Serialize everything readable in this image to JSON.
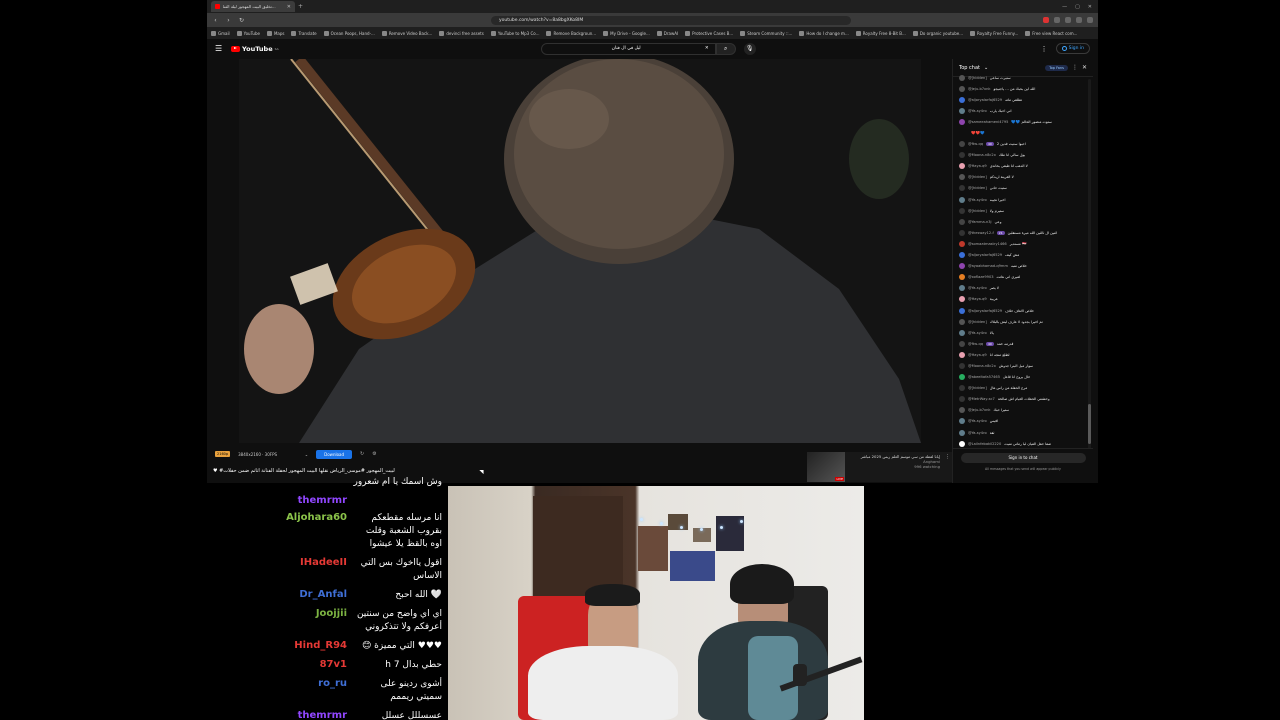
{
  "browser": {
    "tab_title": "تخليق البيت المهجور ليلة الفنا...",
    "url": "youtube.com/watch?v=8a8bgXKo8IM",
    "bookmarks": [
      "Gmail",
      "YouTube",
      "Maps",
      "Translate",
      "Ocean Poops, Hand-...",
      "Remove Video Back...",
      "devinci free assets",
      "YouTube to Mp3 Co...",
      "Remove Backgroun...",
      "My Drive - Google...",
      "DrawAI",
      "Protective Cases B...",
      "Steam Community ::...",
      "How do I change m...",
      "Royalty Free 8-Bit B...",
      "Do organic youtube...",
      "Royalty Free Funny...",
      "Free view React com..."
    ]
  },
  "youtube": {
    "logo": "YouTube",
    "logo_sup": "SA",
    "search_value": "ليل في ال فنان",
    "signin": "Sign in"
  },
  "downloader": {
    "badge": "2160p",
    "quality": "3840x2160 · 30FPS",
    "button": "Download"
  },
  "video_title": {
    "prefix": "كيف نصرفت #لبيت_المهجور #",
    "highlight": "#لبيت_المهجور ليلة الفنانة اتاتم ضمن حفلات",
    "full": "♥ #لبيت_المهجور #موسى_الرياض نقلها البيت المهجور لحفلة الفنانة اتاتم ضمن حفلات"
  },
  "live_card": {
    "title": "إيانا لقطة من سي موسم العلم ريس 2025 مباشر",
    "channel": "Anghami",
    "watching": "996 watching",
    "live": "LIVE"
  },
  "chat": {
    "header": "Top chat",
    "top_fans": "Top Fans",
    "signin": "Sign in to chat",
    "note": "All messages that you send will appear publicly",
    "messages": [
      {
        "user": "@[hidden]",
        "text": "ستيرت ساعي",
        "color": "#555"
      },
      {
        "user": "@Jeju-b7xnk",
        "text": "الله اين بحبك من ... ياجنيجو",
        "color": "#555"
      },
      {
        "user": "@aljoryalarfaj6529",
        "text": "تطلقي ماته",
        "color": "#3a6fd8"
      },
      {
        "user": "@Ya-sy4ro",
        "text": "اني احبك يارب",
        "color": "#607d8b"
      },
      {
        "user": "@sameeahameni4795",
        "text": "💙💙 ستوت منصور الحالم",
        "color": "#8e44ad"
      },
      {
        "user": "",
        "text": "❤️❤️💙",
        "color": "transparent"
      },
      {
        "user": "@ftw-qq",
        "text": "احبوا ستيت فدين 2",
        "pill": "40",
        "color": "#444"
      },
      {
        "user": "@Moona-n8c2x",
        "text": "يول سالي انا ملك",
        "color": "#333"
      },
      {
        "user": "@Haya-q9",
        "text": "لا الدهب انا طبقي بخاندي",
        "color": "#e8a0b0"
      },
      {
        "user": "@[hidden]",
        "text": "لا الغرينة اريدكم",
        "color": "#555"
      },
      {
        "user": "@[hidden]",
        "text": "ستيت حاني",
        "color": "#333"
      },
      {
        "user": "@Ya-sy4ro",
        "text": "اخيرا نجيبه",
        "color": "#607d8b"
      },
      {
        "user": "@[hidden]",
        "text": "ستيرم ولا",
        "color": "#333"
      },
      {
        "user": "@Yamma-n3j",
        "text": "وعي",
        "color": "#444"
      },
      {
        "user": "@thesway12-f",
        "text": "اثنين ال ثالثين الله ميرة مستقلين",
        "pill": "21",
        "color": "#333"
      },
      {
        "user": "@somaatmastry1466",
        "text": "مستدبر 🇪🇬",
        "color": "#c0392b"
      },
      {
        "user": "@aljoryalarfaj6529",
        "text": "مش كيف",
        "color": "#3a6fd8"
      },
      {
        "user": "@ayaabhamad-q9mm",
        "text": "خلاص منبه",
        "color": "#8e44ad"
      },
      {
        "user": "@xoflaze9903",
        "text": "لفيري اني هاتت",
        "color": "#e67e22"
      },
      {
        "user": "@Ya-sy4ro",
        "text": "لا يصر",
        "color": "#607d8b"
      },
      {
        "user": "@Haya-q9",
        "text": "عربية",
        "color": "#e8a0b0"
      },
      {
        "user": "@aljoryalarfaj6529",
        "text": "خلاص الاهاف خلاف",
        "color": "#3a6fd8"
      },
      {
        "user": "@[hidden]",
        "text": "تم اخيرا بجدود لا عارف ليش بالبلاك",
        "color": "#555"
      },
      {
        "user": "@Ya-sy4ro",
        "text": "يالا",
        "color": "#607d8b"
      },
      {
        "user": "@ftw-qq",
        "text": "قدرمه خمد",
        "pill": "40",
        "color": "#444"
      },
      {
        "user": "@Haya-q9",
        "text": "لطلع منجه انا",
        "color": "#e8a0b0"
      },
      {
        "user": "@Moona-n8c2x",
        "text": "سوار ميل البنرا جدوش",
        "color": "#333"
      },
      {
        "user": "@abeeltafa57465",
        "text": "خال يروح انا قاعل",
        "color": "#27ae60"
      },
      {
        "user": "@[hidden]",
        "text": "مرج الحفلة من راس هال",
        "color": "#333"
      },
      {
        "user": "@MetrWay-sc7",
        "text": "وحشتني الحفلات الغيام اش صالخة",
        "color": "#333"
      },
      {
        "user": "@Jeju-b7xnk",
        "text": "ستيرا حبك",
        "color": "#555"
      },
      {
        "user": "@Ya-sy4ro",
        "text": "افيس",
        "color": "#607d8b"
      },
      {
        "user": "@Ya-sy4ro",
        "text": "ثقة",
        "color": "#607d8b"
      },
      {
        "user": "@Lailnfebakil2220",
        "text": "صفا حفل الفيان لبا رماني منيت",
        "color": "#fff"
      }
    ]
  },
  "overlay_chat": [
    {
      "name": "",
      "text": "وش اسمك يا ام شعرور",
      "color": "#9147ff"
    },
    {
      "name": "themrmr",
      "text": "",
      "color": "#9147ff"
    },
    {
      "name": "Aljohara60",
      "text": "انا مرسله مقطعكم بقروب الشعبة وقلت اوه بالقظ يلا عيشوا",
      "color": "#8bc34a"
    },
    {
      "name": "IHadeeII",
      "text": "اقول يااخوك بس التي الاساس",
      "color": "#e53935"
    },
    {
      "name": "Dr_Anfal",
      "text": "🤍 الله احبح",
      "color": "#3f6fd6"
    },
    {
      "name": "Joojjii",
      "text": "اي اي واضح من سنتين أعرفكم ولا تتذكروني",
      "color": "#7cb342"
    },
    {
      "name": "Hind_R94",
      "text": "♥♥♥ التي مميزة 😊",
      "color": "#e53935"
    },
    {
      "name": "87v1",
      "text": "حطي بدال h 7",
      "color": "#e53935"
    },
    {
      "name": "ro_ru",
      "text": "أشوى ردينو على سميتي ريممم",
      "color": "#3f6fd6"
    },
    {
      "name": "themrmr",
      "text": "عسسللل عسلل",
      "color": "#9147ff"
    }
  ]
}
